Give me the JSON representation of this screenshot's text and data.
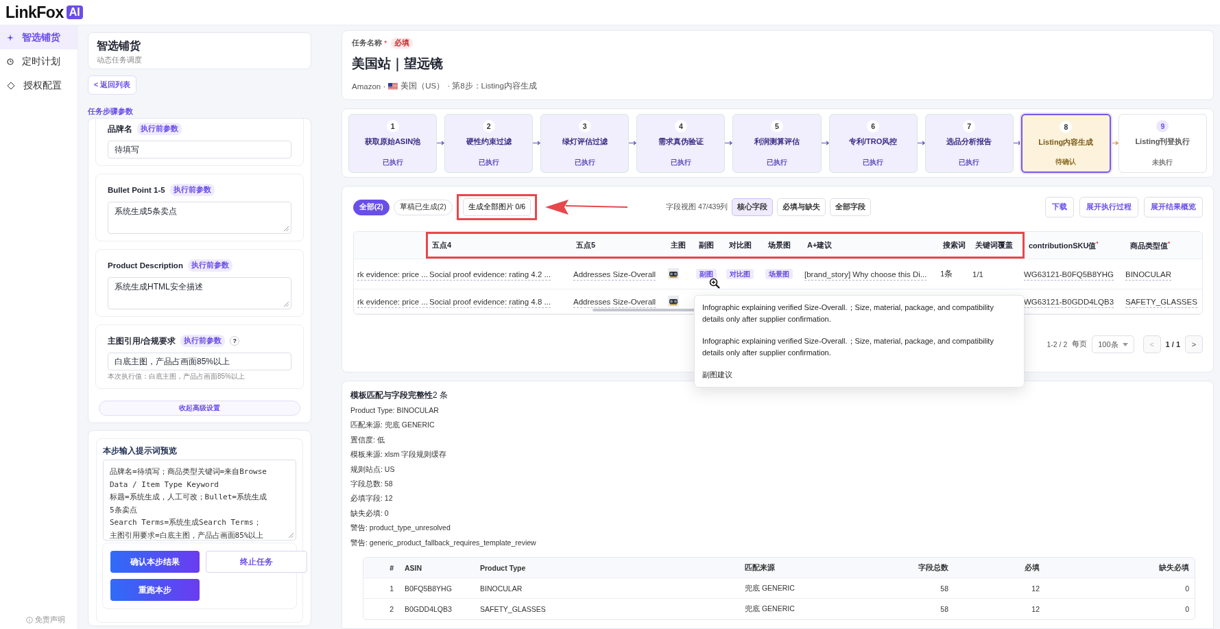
{
  "app": {
    "logo_text": "LinkFox",
    "logo_badge": "AI"
  },
  "sidebar": {
    "items": [
      {
        "label": "智选铺货",
        "selected": true
      },
      {
        "label": "定时计划",
        "selected": false
      },
      {
        "label": "授权配置",
        "selected": false
      }
    ],
    "footer": "免责声明"
  },
  "task_panel": {
    "title": "智选铺货",
    "subtitle": "动态任务调度",
    "back_button": "< 返回列表",
    "section_title": "任务步骤参数",
    "params": [
      {
        "kind": "input",
        "label": "品牌名",
        "badge": "执行前参数",
        "value": "待填写"
      },
      {
        "kind": "textarea",
        "label": "Bullet Point 1-5",
        "badge": "执行前参数",
        "value": "系统生成5条卖点"
      },
      {
        "kind": "textarea",
        "label": "Product Description",
        "badge": "执行前参数",
        "value": "系统生成HTML安全描述"
      },
      {
        "kind": "input",
        "label": "主图引用/合规要求",
        "badge": "执行前参数",
        "help": "?",
        "value": "白底主图，产品占画面85%以上",
        "note": "本次执行值：白底主图，产品占画面85%以上"
      }
    ],
    "collapse_button": "收起高级设置",
    "prompt": {
      "title": "本步输入提示词预览",
      "lines": [
        "品牌名=待填写；商品类型关键词=来自Browse",
        "Data / Item Type Keyword",
        "标题=系统生成，人工可改；Bullet=系统生成",
        "5条卖点",
        "Search Terms=系统生成Search Terms；",
        "主图引用要求=白底主图，产品占画面85%以上"
      ]
    },
    "actions": [
      {
        "label": "确认本步结果",
        "kind": "primary"
      },
      {
        "label": "终止任务",
        "kind": "outline"
      },
      {
        "label": "重跑本步",
        "kind": "primary"
      }
    ]
  },
  "task": {
    "label": "任务名称",
    "required_mark": "*",
    "required_badge": "必填",
    "name": "美国站｜望远镜",
    "platform": "Amazon ·",
    "country": "美国（US）",
    "step_info": "· 第8步：Listing内容生成"
  },
  "steps": [
    {
      "number": "1",
      "label": "获取原始ASIN池",
      "status": "已执行",
      "kind": "done"
    },
    {
      "number": "2",
      "label": "硬性约束过滤",
      "status": "已执行",
      "kind": "done"
    },
    {
      "number": "3",
      "label": "绿灯评估过滤",
      "status": "已执行",
      "kind": "done"
    },
    {
      "number": "4",
      "label": "需求真伪验证",
      "status": "已执行",
      "kind": "done"
    },
    {
      "number": "5",
      "label": "利润测算评估",
      "status": "已执行",
      "kind": "done"
    },
    {
      "number": "6",
      "label": "专利/TRO风控",
      "status": "已执行",
      "kind": "done"
    },
    {
      "number": "7",
      "label": "选品分析报告",
      "status": "已执行",
      "kind": "done"
    },
    {
      "number": "8",
      "label": "Listing内容生成",
      "status": "待确认",
      "kind": "current"
    },
    {
      "number": "9",
      "label": "Listing刊登执行",
      "status": "未执行",
      "kind": "pending"
    }
  ],
  "toolbar": {
    "filters": [
      {
        "label": "全部(2)",
        "selected": true
      },
      {
        "label": "草稿已生成(2)",
        "selected": false
      }
    ],
    "generate_button": {
      "label": "生成全部图片 0/6",
      "highlighted": true
    },
    "field_view": {
      "label": "字段视图 47/439列",
      "options": [
        {
          "label": "核心字段",
          "selected": true
        },
        {
          "label": "必填与缺失",
          "selected": false
        },
        {
          "label": "全部字段",
          "selected": false
        }
      ]
    },
    "actions": [
      "下载",
      "展开执行过程",
      "展开结果概览"
    ]
  },
  "annotations": {
    "arrow": true,
    "columns_highlight": true
  },
  "table": {
    "columns": [
      null,
      {
        "label": "五点4"
      },
      {
        "label": "五点5"
      },
      {
        "label": "主图"
      },
      {
        "label": "副图"
      },
      {
        "label": "对比图"
      },
      {
        "label": "场景图"
      },
      {
        "label": "A+建议"
      },
      {
        "label": "搜索词"
      },
      {
        "label": "关键词覆盖"
      },
      {
        "label": "contributionSKU值",
        "required_mark": "•"
      },
      {
        "label": "商品类型值",
        "required_mark": "•"
      }
    ],
    "rows": [
      {
        "cells": [
          {
            "kind": "text",
            "text": "rk evidence: price ..."
          },
          {
            "kind": "text",
            "text": "Social proof evidence: rating 4.2 ..."
          },
          {
            "kind": "text",
            "text": "Addresses Size-Overall"
          },
          {
            "kind": "thumb"
          },
          {
            "kind": "tag",
            "text": "副图",
            "hovered": true
          },
          {
            "kind": "tag",
            "text": "对比图"
          },
          {
            "kind": "tag",
            "text": "场景图"
          },
          {
            "kind": "text",
            "text": "[brand_story] Why choose this Di..."
          },
          {
            "kind": "plain",
            "text": "1条"
          },
          {
            "kind": "plain",
            "text": "1/1"
          },
          {
            "kind": "text",
            "text": "WG63121-B0FQ5B8YHG"
          },
          {
            "kind": "text",
            "text": "BINOCULAR"
          }
        ]
      },
      {
        "cells": [
          {
            "kind": "text",
            "text": "rk evidence: price ..."
          },
          {
            "kind": "text",
            "text": "Social proof evidence: rating 4.8 ..."
          },
          {
            "kind": "text",
            "text": "Addresses Size-Overall"
          },
          {
            "kind": "thumb"
          },
          null,
          null,
          null,
          null,
          null,
          null,
          {
            "kind": "text",
            "text": "WG63121-B0GDD4LQB3"
          },
          {
            "kind": "text",
            "text": "SAFETY_GLASSES"
          }
        ]
      }
    ]
  },
  "tooltip": {
    "paragraphs": [
      "Infographic explaining verified Size-Overall.；Size, material, package, and compatibility details only after supplier confirmation.",
      "Infographic explaining verified Size-Overall.；Size, material, package, and compatibility details only after supplier confirmation."
    ],
    "footer": "副图建议"
  },
  "pagination": {
    "range": "1-2 / 2",
    "per_page_label": "每页",
    "per_page": "100条",
    "prev": "<",
    "page": "1 / 1",
    "next": ">",
    "prev_disabled": true
  },
  "summary": {
    "title": "**模板匹配与字段完整性**2 条",
    "lines": [
      "Product Type: BINOCULAR",
      "匹配来源: 兜底 GENERIC",
      "置信度: 低",
      "模板来源: xlsm 字段规则缓存",
      "规则站点: US",
      "字段总数: 58",
      "必填字段: 12",
      "缺失必填: 0",
      "警告: product_type_unresolved",
      "警告: generic_product_fallback_requires_template_review"
    ],
    "table": {
      "columns": [
        "#",
        "ASIN",
        "Product Type",
        "匹配来源",
        "字段总数",
        "必填",
        "缺失必填"
      ],
      "rows": [
        [
          "1",
          "B0FQ5B8YHG",
          "BINOCULAR",
          "兜底 GENERIC",
          "58",
          "12",
          "0"
        ],
        [
          "2",
          "B0GDD4LQB3",
          "SAFETY_GLASSES",
          "兜底 GENERIC",
          "58",
          "12",
          "0"
        ]
      ]
    }
  }
}
